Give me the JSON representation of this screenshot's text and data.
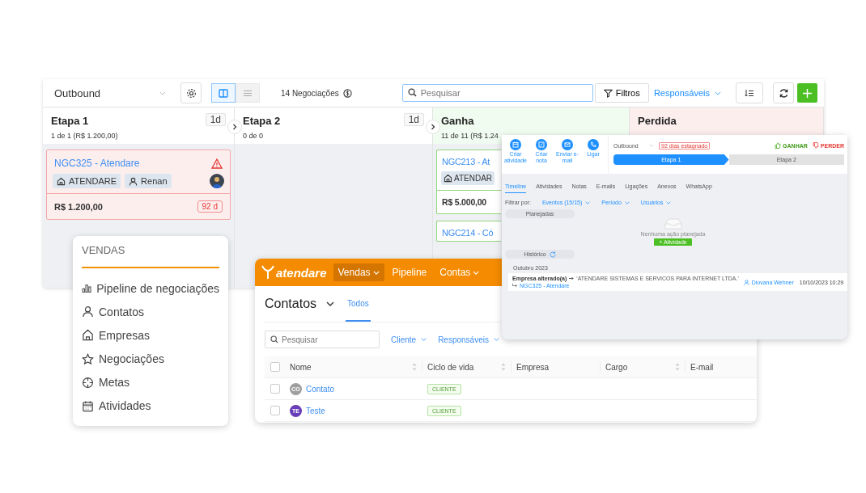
{
  "pipeline": {
    "selector": "Outbound",
    "views": [
      {
        "kind": "columns",
        "selected": true
      },
      {
        "kind": "list",
        "selected": false
      }
    ],
    "deal_count": "14 Negociações",
    "search": {
      "placeholder": "Pesquisar"
    },
    "filters_button": "Filtros",
    "owners_dropdown": "Responsáveis",
    "columns": [
      {
        "title": "Etapa 1",
        "duration": "1d",
        "summary": "1 de 1 (R$ 1.200,00)",
        "kind": "open",
        "cards": [
          {
            "title": "NGC325 - Atendare",
            "alert": true,
            "avatar": true,
            "tags": [
              {
                "kind": "company",
                "label": "ATENDARE"
              },
              {
                "kind": "person",
                "label": "Renan"
              }
            ],
            "value": "R$ 1.200,00",
            "age": "92 d"
          }
        ]
      },
      {
        "title": "Etapa 2",
        "duration": "1d",
        "summary": "0 de 0",
        "kind": "open"
      },
      {
        "title": "Ganha",
        "summary": "11 de 11 (R$ 1.24",
        "kind": "won",
        "cards": [
          {
            "title": "NGC213 - At",
            "tags": [
              {
                "kind": "company",
                "label": "ATENDAR"
              }
            ],
            "value": "R$ 5.000,00"
          },
          {
            "title": "NGC214 - Có"
          }
        ]
      },
      {
        "title": "Perdida",
        "kind": "lost"
      }
    ]
  },
  "sales_menu": {
    "heading": "VENDAS",
    "items": [
      {
        "kind": "chart",
        "label": "Pipeline de negociações"
      },
      {
        "kind": "person",
        "label": "Contatos"
      },
      {
        "kind": "home",
        "label": "Empresas"
      },
      {
        "kind": "star",
        "label": "Negociações"
      },
      {
        "kind": "target",
        "label": "Metas"
      },
      {
        "kind": "calendar",
        "label": "Atividades"
      }
    ]
  },
  "contacts_window": {
    "logo": "atendare",
    "nav": [
      {
        "label": "Vendas",
        "selected": true,
        "dropdown": true
      },
      {
        "label": "Pipeline",
        "selected": false,
        "dropdown": false
      },
      {
        "label": "Contas",
        "selected": false,
        "dropdown": true
      }
    ],
    "title": "Contatos",
    "views": [
      {
        "label": "Todos",
        "selected": true
      }
    ],
    "search": {
      "placeholder": "Pesquisar"
    },
    "filters": [
      "Cliente",
      "Responsáveis"
    ],
    "select_all": {
      "checked": false
    },
    "columns": [
      {
        "label": "Nome",
        "sortable": true
      },
      {
        "label": "Ciclo de vida",
        "sortable": true
      },
      {
        "label": "Empresa"
      },
      {
        "label": "Cargo",
        "sortable": true
      },
      {
        "label": "E-mail"
      }
    ],
    "rows": [
      {
        "checked": false,
        "initials": "CO",
        "color": "#9e9e9e",
        "name": "Contato",
        "stage": "CLIENTE"
      },
      {
        "checked": false,
        "initials": "TE",
        "color": "#6a3db8",
        "name": "Teste",
        "stage": "CLIENTE"
      }
    ]
  },
  "deal_window": {
    "actions": [
      {
        "kind": "calendar",
        "label": "Criar atividade"
      },
      {
        "kind": "note",
        "label": "Criar nota"
      },
      {
        "kind": "mail",
        "label": "Enviar e-mail"
      },
      {
        "kind": "phone",
        "label": "Ligar"
      }
    ],
    "pipeline": "Outbound",
    "stagnation": "92 dias estagnado",
    "win": "GANHAR",
    "lose": "PERDER",
    "stages": [
      {
        "label": "Etapa 1",
        "selected": true
      },
      {
        "label": "Etapa 2",
        "selected": false
      }
    ],
    "tabs": [
      {
        "label": "Timeline",
        "selected": true
      },
      {
        "label": "Atividades",
        "selected": false
      },
      {
        "label": "Notas",
        "selected": false
      },
      {
        "label": "E-mails",
        "selected": false
      },
      {
        "label": "Ligações",
        "selected": false
      },
      {
        "label": "Anexos",
        "selected": false
      },
      {
        "label": "WhatsApp",
        "selected": false
      }
    ],
    "filter_label": "Filtrar por:",
    "filters": [
      "Eventos (15/15)",
      "Período",
      "Usuários"
    ],
    "planned": {
      "heading": "Planejadas",
      "empty": "Nenhuma ação planejada",
      "button": "+ Atividade"
    },
    "history": {
      "heading": "Histórico",
      "month": "Outubro 2023",
      "event": {
        "title": "Empresa alterado(a)",
        "value": "'ATENDARE SISTEMAS E SERVICOS PARA INTERNET LTDA.'",
        "deal": "NGC325 - Atendare",
        "user": "Diovana Wehner",
        "date": "10/10/2023 10:29"
      }
    }
  }
}
